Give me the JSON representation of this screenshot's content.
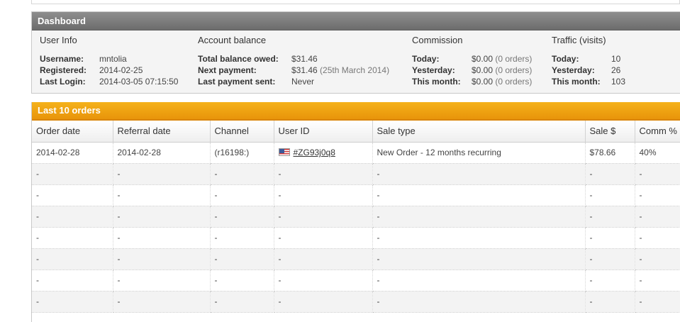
{
  "dashboard": {
    "title": "Dashboard",
    "user_info": {
      "title": "User Info",
      "rows": [
        {
          "key": "Username:",
          "value": "mntolia"
        },
        {
          "key": "Registered:",
          "value": "2014-02-25"
        },
        {
          "key": "Last Login:",
          "value": "2014-03-05 07:15:50"
        }
      ]
    },
    "account_balance": {
      "title": "Account balance",
      "rows": [
        {
          "key": "Total balance owed:",
          "value": "$31.46",
          "note": ""
        },
        {
          "key": "Next payment:",
          "value": "$31.46",
          "note": "(25th March 2014)"
        },
        {
          "key": "Last payment sent:",
          "value": "Never",
          "note": ""
        }
      ]
    },
    "commission": {
      "title": "Commission",
      "rows": [
        {
          "key": "Today:",
          "value": "$0.00",
          "note": "(0 orders)"
        },
        {
          "key": "Yesterday:",
          "value": "$0.00",
          "note": "(0 orders)"
        },
        {
          "key": "This month:",
          "value": "$0.00",
          "note": "(0 orders)"
        }
      ]
    },
    "traffic": {
      "title": "Traffic (visits)",
      "rows": [
        {
          "key": "Today:",
          "value": "10"
        },
        {
          "key": "Yesterday:",
          "value": "26"
        },
        {
          "key": "This month:",
          "value": "103"
        }
      ]
    }
  },
  "orders": {
    "title": "Last 10 orders",
    "columns": [
      "Order date",
      "Referral date",
      "Channel",
      "User ID",
      "Sale type",
      "Sale $",
      "Comm %"
    ],
    "rows": [
      [
        "2014-02-28",
        "2014-02-28",
        "(r16198:)",
        "#ZG93j0q8",
        "New Order - 12 months recurring",
        "$78.66",
        "40%"
      ],
      [
        "-",
        "-",
        "-",
        "-",
        "-",
        "-",
        "-"
      ],
      [
        "-",
        "-",
        "-",
        "-",
        "-",
        "-",
        "-"
      ],
      [
        "-",
        "-",
        "-",
        "-",
        "-",
        "-",
        "-"
      ],
      [
        "-",
        "-",
        "-",
        "-",
        "-",
        "-",
        "-"
      ],
      [
        "-",
        "-",
        "-",
        "-",
        "-",
        "-",
        "-"
      ],
      [
        "-",
        "-",
        "-",
        "-",
        "-",
        "-",
        "-"
      ],
      [
        "-",
        "-",
        "-",
        "-",
        "-",
        "-",
        "-"
      ]
    ],
    "first_row_flag_icon": "us-flag-icon"
  },
  "colors": {
    "dashboard_header": "#7a7a7a",
    "orders_header": "#f0a010"
  }
}
